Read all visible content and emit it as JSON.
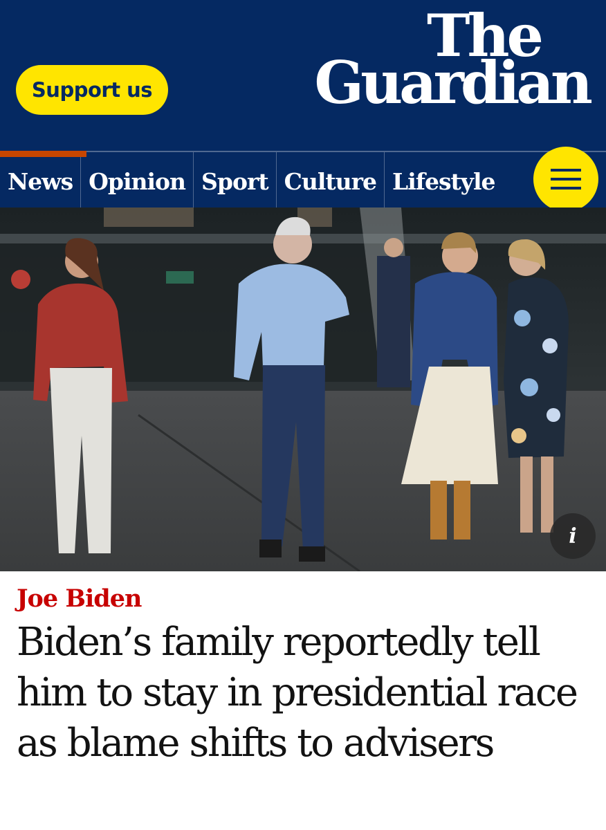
{
  "header": {
    "support_label": "Support us",
    "logo_line1": "The",
    "logo_line2": "Guardian"
  },
  "nav": {
    "items": [
      {
        "label": "News"
      },
      {
        "label": "Opinion"
      },
      {
        "label": "Sport"
      },
      {
        "label": "Culture"
      },
      {
        "label": "Lifestyle"
      }
    ],
    "active_index": 0,
    "menu_icon": "hamburger-icon"
  },
  "hero": {
    "info_label": "i",
    "info_icon": "info-icon"
  },
  "article": {
    "kicker": "Joe Biden",
    "headline": "Biden’s family reportedly tell him to stay in presidential race as blame shifts to advisers"
  },
  "colors": {
    "brand_blue": "#052962",
    "brand_yellow": "#ffe500",
    "news_red": "#c70000",
    "nav_active": "#c74600"
  }
}
